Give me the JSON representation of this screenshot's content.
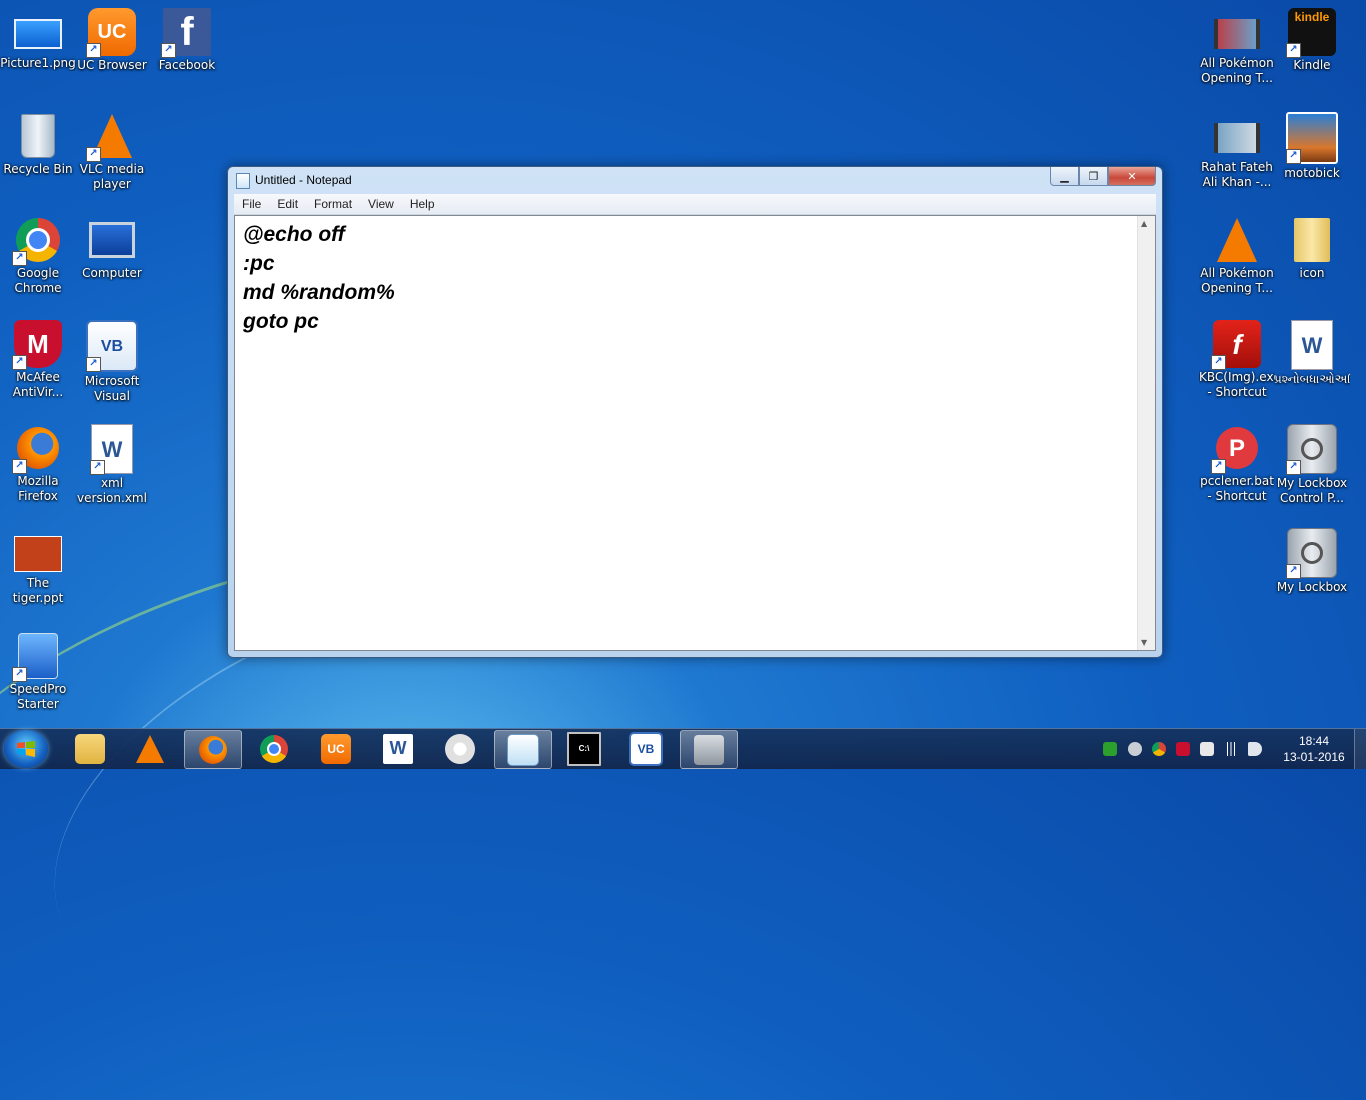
{
  "desktop": {
    "left_icons": [
      {
        "label": "Picture1.png",
        "icon": "image-file-icon"
      },
      {
        "label": "UC Browser",
        "icon": "uc-browser-icon"
      },
      {
        "label": "Facebook",
        "icon": "facebook-icon"
      },
      {
        "label": "Recycle Bin",
        "icon": "recycle-bin-icon"
      },
      {
        "label": "VLC media player",
        "icon": "vlc-icon"
      },
      {
        "label": "Google Chrome",
        "icon": "chrome-icon"
      },
      {
        "label": "Computer",
        "icon": "computer-icon"
      },
      {
        "label": "McAfee AntiVir...",
        "icon": "mcafee-icon"
      },
      {
        "label": "Microsoft Visual Basi...",
        "icon": "visual-basic-icon"
      },
      {
        "label": "Mozilla Firefox",
        "icon": "firefox-icon"
      },
      {
        "label": "xml version.xml",
        "icon": "word-document-icon"
      },
      {
        "label": "The tiger.ppt",
        "icon": "powerpoint-file-icon"
      },
      {
        "label": "SpeedPro Starter",
        "icon": "speedpro-icon"
      }
    ],
    "right_icons": [
      {
        "label": "All Pokémon Opening T...",
        "icon": "video-file-icon"
      },
      {
        "label": "Kindle",
        "icon": "kindle-icon",
        "badge": "kindle"
      },
      {
        "label": "Rahat Fateh Ali Khan -...",
        "icon": "video-file-icon"
      },
      {
        "label": "motobick",
        "icon": "image-shortcut-icon"
      },
      {
        "label": "All Pokémon Opening T...",
        "icon": "vlc-icon"
      },
      {
        "label": "icon",
        "icon": "folder-icon"
      },
      {
        "label": "KBC(Img).exe - Shortcut",
        "icon": "flash-icon"
      },
      {
        "label": "પ્રશ્નોબધાઓઅશિ...",
        "icon": "word-document-icon"
      },
      {
        "label": "pcclener.bat - Shortcut",
        "icon": "p-app-icon"
      },
      {
        "label": "My Lockbox Control P...",
        "icon": "lockbox-icon"
      },
      {
        "label": "My Lockbox",
        "icon": "lockbox-icon"
      }
    ]
  },
  "notepad": {
    "title": "Untitled - Notepad",
    "menu": [
      "File",
      "Edit",
      "Format",
      "View",
      "Help"
    ],
    "content": "@echo off\n:pc\nmd %random%\ngoto pc",
    "minimize_glyph": "▁",
    "maximize_glyph": "❐",
    "close_glyph": "✕"
  },
  "taskbar": {
    "pinned": [
      "explorer-icon",
      "vlc-icon",
      "firefox-icon",
      "chrome-icon",
      "uc-browser-icon",
      "word-icon",
      "paint-icon",
      "notepad-icon",
      "cmd-icon",
      "visual-basic-icon",
      "camera-icon"
    ],
    "active": [
      "firefox-icon",
      "notepad-icon",
      "camera-icon"
    ],
    "clock_time": "18:44",
    "clock_date": "13-01-2016"
  },
  "colors": {
    "desktop_blue": "#0f5fc0",
    "close_red": "#c9483a",
    "taskbar": "#14325f"
  }
}
